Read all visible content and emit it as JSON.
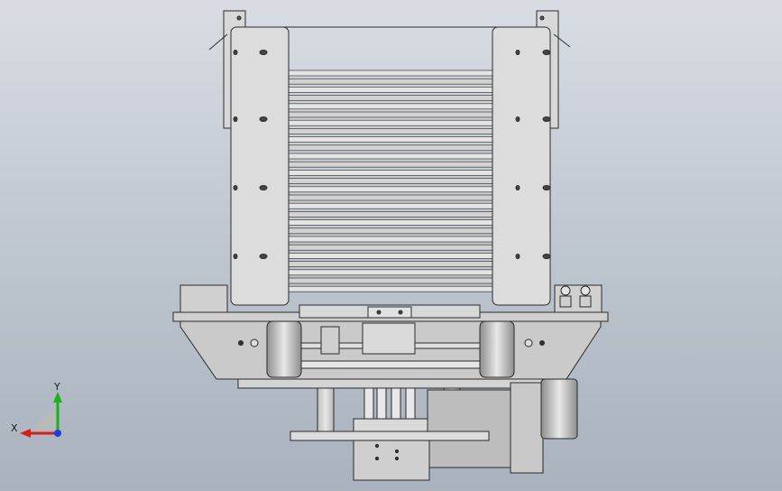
{
  "view": {
    "title": "",
    "colors": {
      "background_top": "#d9dde3",
      "background_bottom": "#a9b2bd",
      "part_fill": "#d6d6d6",
      "part_dark": "#9a9a9a",
      "edge": "#2b2b2b",
      "axis_x": "#d21f1f",
      "axis_y": "#19b219",
      "axis_z": "#1f3fd6"
    }
  },
  "triad": {
    "x_label": "X",
    "y_label": "Y",
    "icon": "coordinate-triad-icon"
  }
}
